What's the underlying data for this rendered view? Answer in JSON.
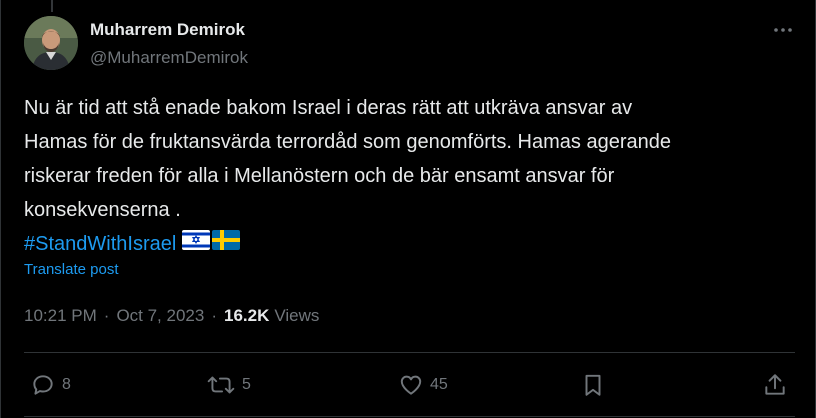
{
  "author": {
    "name": "Muharrem Demirok",
    "handle": "@MuharremDemirok"
  },
  "post": {
    "lines": [
      "Nu är tid att stå enade bakom Israel i deras rätt att utkräva ansvar av",
      "Hamas för de fruktansvärda terrordåd som genomförts. Hamas agerande",
      "riskerar freden för alla i Mellanöstern och de bär ensamt ansvar för",
      "konsekvenserna ."
    ],
    "hashtag": "#StandWithIsrael",
    "flags": [
      "flag-israel-icon",
      "flag-sweden-icon"
    ],
    "translate_label": "Translate post"
  },
  "meta": {
    "time": "10:21 PM",
    "separator": "·",
    "date": "Oct 7, 2023",
    "views_count": "16.2K",
    "views_label": "Views"
  },
  "actions": {
    "replies": "8",
    "reposts": "5",
    "likes": "45"
  },
  "colors": {
    "background": "#000000",
    "text": "#e7e9ea",
    "secondary": "#71767b",
    "accent": "#1d9bf0",
    "border": "#2f3336"
  },
  "icons": [
    "more-icon",
    "reply-icon",
    "repost-icon",
    "like-icon",
    "bookmark-icon",
    "share-icon"
  ]
}
